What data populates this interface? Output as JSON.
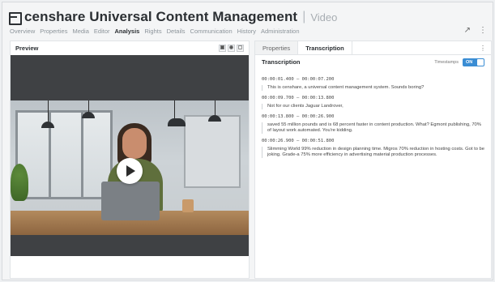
{
  "header": {
    "title": "censhare Universal Content Management",
    "separator": "|",
    "subtitle": "Video"
  },
  "tabs": [
    {
      "label": "Overview",
      "active": false
    },
    {
      "label": "Properties",
      "active": false
    },
    {
      "label": "Media",
      "active": false
    },
    {
      "label": "Editor",
      "active": false
    },
    {
      "label": "Analysis",
      "active": true
    },
    {
      "label": "Rights",
      "active": false
    },
    {
      "label": "Details",
      "active": false
    },
    {
      "label": "Communication",
      "active": false
    },
    {
      "label": "History",
      "active": false
    },
    {
      "label": "Administration",
      "active": false
    }
  ],
  "header_icons": {
    "expand": "↗",
    "more": "⋮"
  },
  "preview": {
    "title": "Preview",
    "icons": {
      "camera": "▣",
      "eye": "◉",
      "pip": "▢"
    }
  },
  "right_panel": {
    "tabs": [
      {
        "label": "Properties",
        "active": false
      },
      {
        "label": "Transcription",
        "active": true
      }
    ],
    "more": "⋮",
    "transcription_title": "Transcription",
    "timestamps_label": "Timestamps",
    "toggle_label": "ON",
    "entries": [
      {
        "time": "00:00:01.400 – 00:00:07.200",
        "text": "This is censhare, a universal content management system. Sounds boring?"
      },
      {
        "time": "00:00:09.700 – 00:00:13.800",
        "text": "Not for our clients Jaguar Landrover,"
      },
      {
        "time": "00:00:13.800 – 00:00:26.900",
        "text": "saved 55 million pounds and is 68 percent faster in content production. What? Egmont publishing, 70% of layout work automated. You're kidding."
      },
      {
        "time": "00:00:26.900 – 00:00:51.800",
        "text": "Slimming World 99% reduction in design planning time. Migros 70% reduction in hosting costs. Got to be joking. Grade-a 75% more efficiency in advertising material production processes."
      }
    ]
  },
  "colors": {
    "accent": "#3a8dd4",
    "title": "#2b2f33",
    "video_bg": "#3f4144"
  }
}
